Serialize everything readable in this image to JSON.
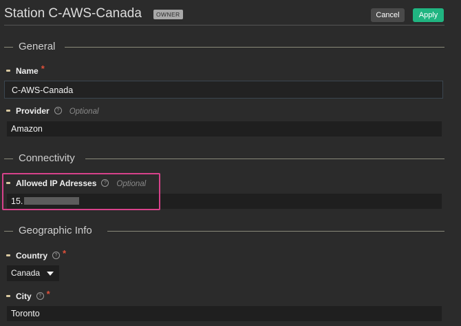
{
  "header": {
    "title": "Station C-AWS-Canada",
    "badge": "OWNER",
    "cancel_label": "Cancel",
    "apply_label": "Apply"
  },
  "sections": {
    "general": "General",
    "connectivity": "Connectivity",
    "geographic": "Geographic Info"
  },
  "fields": {
    "name": {
      "label": "Name",
      "required_mark": "*",
      "value": "C-AWS-Canada"
    },
    "provider": {
      "label": "Provider",
      "help": "?",
      "optional": "Optional",
      "value": "Amazon"
    },
    "allowed_ip": {
      "label": "Allowed IP Adresses",
      "help": "?",
      "optional": "Optional",
      "value": "15."
    },
    "country": {
      "label": "Country",
      "help": "?",
      "required_mark": "*",
      "value": "Canada"
    },
    "city": {
      "label": "City",
      "help": "?",
      "required_mark": "*",
      "value": "Toronto"
    }
  },
  "colors": {
    "apply": "#20b581",
    "highlight": "#d8428b",
    "required": "#e0503a"
  }
}
